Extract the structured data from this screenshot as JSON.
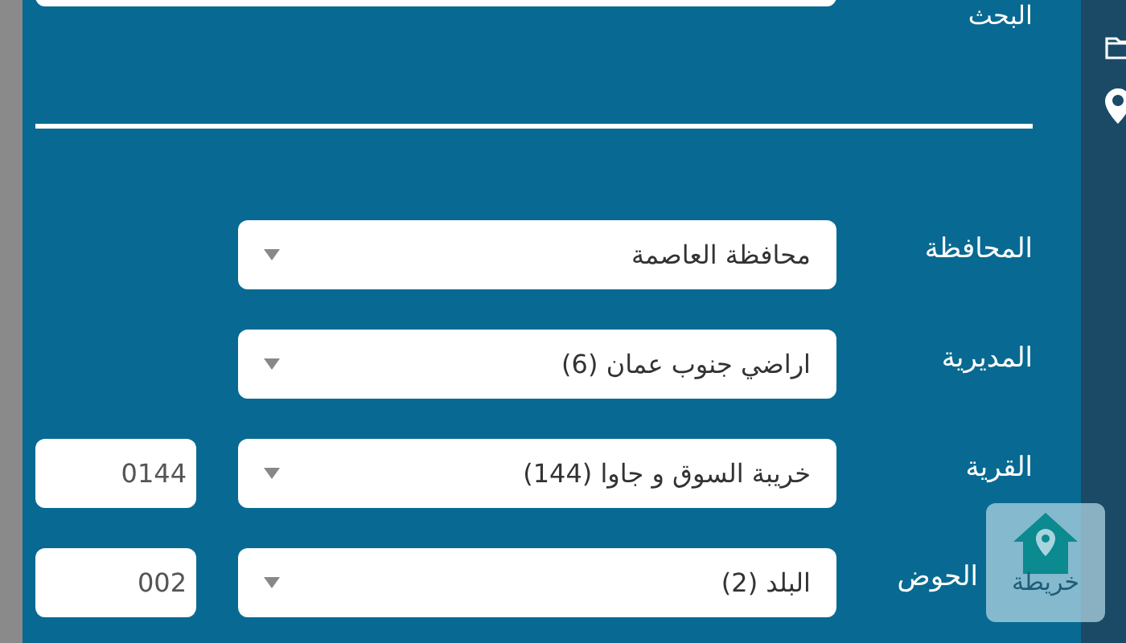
{
  "search": {
    "label": "البحث"
  },
  "fields": [
    {
      "label": "المحافظة",
      "value": "محافظة العاصمة"
    },
    {
      "label": "المديرية",
      "value": "اراضي جنوب عمان (6)"
    },
    {
      "label": "القرية",
      "value": "خريبة السوق و جاوا (144)",
      "code": "0144"
    },
    {
      "label": "الحوض",
      "value": "البلد (2)",
      "code": "002"
    }
  ],
  "map_button": {
    "label": "خريطة"
  }
}
